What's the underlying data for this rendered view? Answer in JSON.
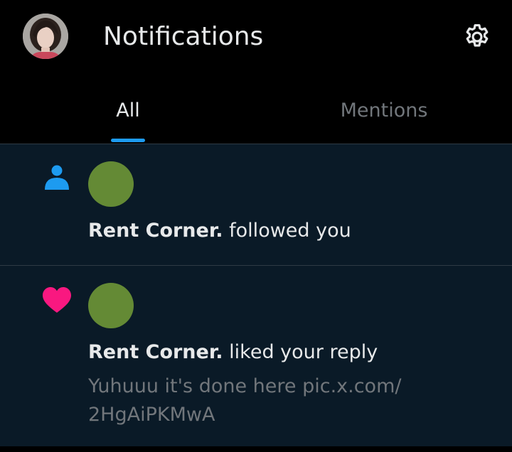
{
  "header": {
    "title": "Notifications",
    "avatar_icon": "profile-avatar",
    "settings_icon": "gear-icon"
  },
  "tabs": [
    {
      "label": "All",
      "active": true
    },
    {
      "label": "Mentions",
      "active": false
    }
  ],
  "notifications": [
    {
      "type": "follow",
      "type_icon": "person-icon",
      "actor_name": "Rent Corner.",
      "action": " followed you",
      "snippet_line1": "",
      "snippet_line2": ""
    },
    {
      "type": "like",
      "type_icon": "heart-icon",
      "actor_name": "Rent Corner.",
      "action": " liked your reply",
      "snippet_line1": "Yuhuuu it's done here pic.x.com/",
      "snippet_line2": "2HgAiPKMwA"
    }
  ],
  "colors": {
    "accent": "#1d9bf0",
    "like": "#f91880",
    "avatar_green": "#648a35",
    "feed_bg": "#0a1a27",
    "header_bg": "#000000",
    "text_primary": "#e7e9ea",
    "text_secondary": "#71767b"
  }
}
